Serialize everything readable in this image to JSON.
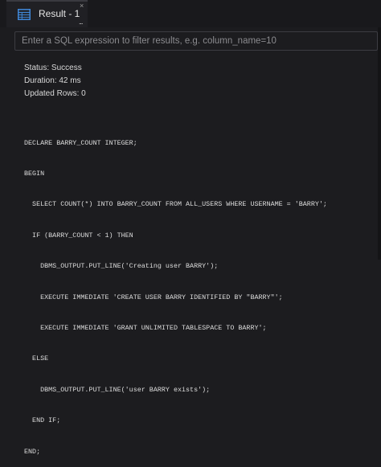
{
  "tab": {
    "icon": "table-grid-icon",
    "label": "Result - 1",
    "close_glyph": "×",
    "more_glyph": "..."
  },
  "filter": {
    "placeholder": "Enter a SQL expression to filter results, e.g. column_name=10",
    "value": ""
  },
  "result": {
    "status": "Status: Success",
    "duration": "Duration: 42 ms",
    "updated_rows": "Updated Rows: 0"
  },
  "script_lines": [
    "DECLARE BARRY_COUNT INTEGER;",
    "BEGIN",
    "  SELECT COUNT(*) INTO BARRY_COUNT FROM ALL_USERS WHERE USERNAME = 'BARRY';",
    "  IF (BARRY_COUNT < 1) THEN",
    "    DBMS_OUTPUT.PUT_LINE('Creating user BARRY');",
    "    EXECUTE IMMEDIATE 'CREATE USER BARRY IDENTIFIED BY \"BARRY\"';",
    "    EXECUTE IMMEDIATE 'GRANT UNLIMITED TABLESPACE TO BARRY';",
    "  ELSE",
    "    DBMS_OUTPUT.PUT_LINE('user BARRY exists');",
    "  END IF;",
    "END;"
  ],
  "colors": {
    "background": "#1c1c1f",
    "tab_icon": "#3f86d6"
  }
}
